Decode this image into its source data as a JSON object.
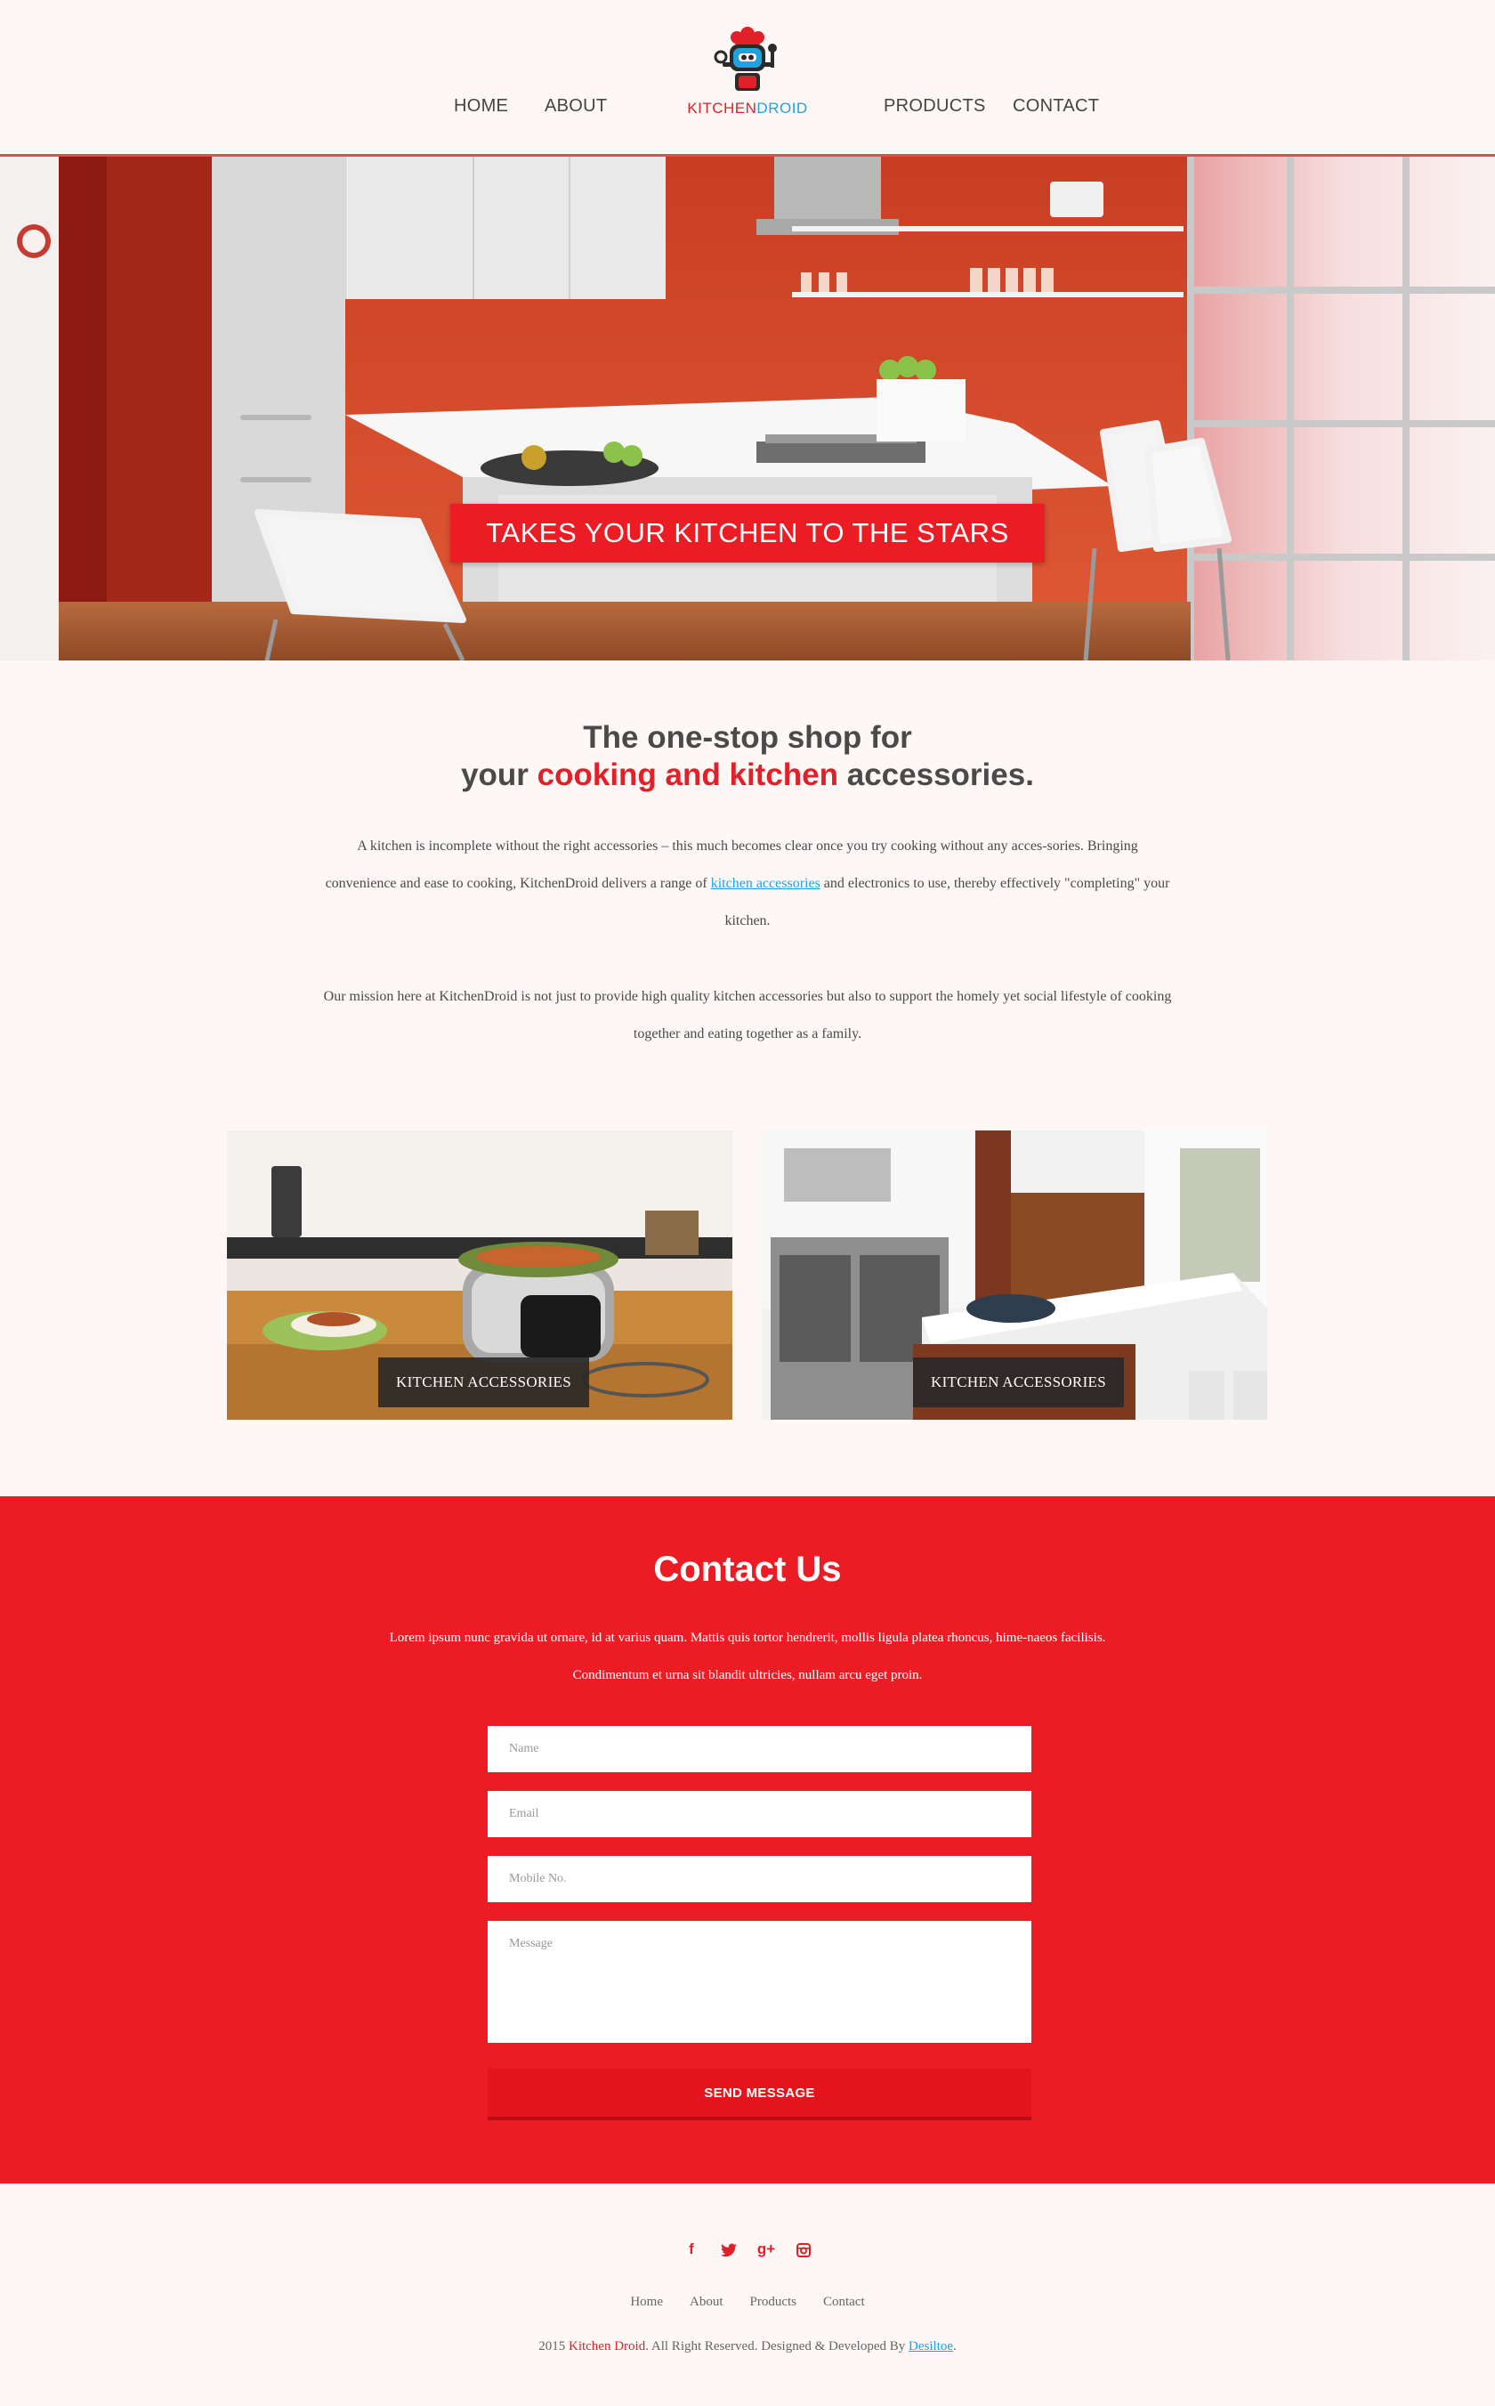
{
  "nav": {
    "home": "HOME",
    "about": "ABOUT",
    "products": "PRODUCTS",
    "contact": "CONTACT"
  },
  "logo": {
    "part1": "KITCHEN",
    "part2": "DROID"
  },
  "hero": {
    "banner": "TAKES YOUR KITCHEN TO THE STARS"
  },
  "intro": {
    "title_line1": "The one-stop shop for",
    "title_pre": "your ",
    "title_highlight": "cooking and kitchen",
    "title_post": " accessories.",
    "p1_a": "A kitchen is incomplete without the right accessories – this much becomes clear once you try cooking without any acces-sories. Bringing convenience and ease to cooking, KitchenDroid delivers a range of ",
    "p1_link": "kitchen accessories",
    "p1_b": " and electronics to use, thereby effectively \"completing\" your kitchen.",
    "p2": "Our mission here at KitchenDroid is not just to provide high quality kitchen accessories but also to support the homely yet social lifestyle of cooking together and eating together as a family."
  },
  "cards": [
    {
      "label": "KITCHEN ACCESSORIES"
    },
    {
      "label": "KITCHEN ACCESSORIES"
    }
  ],
  "contact": {
    "title": "Contact Us",
    "text": "Lorem ipsum nunc gravida ut ornare, id at varius quam. Mattis quis tortor hendrerit, mollis ligula platea rhoncus, hime-naeos facilisis. Condimentum et urna sit blandit ultricies, nullam arcu eget proin.",
    "name_placeholder": "Name",
    "email_placeholder": "Email",
    "mobile_placeholder": "Mobile No.",
    "message_placeholder": "Message",
    "send_label": "SEND MESSAGE"
  },
  "footer": {
    "socials": [
      {
        "icon": "facebook-icon",
        "glyph": "f"
      },
      {
        "icon": "twitter-icon",
        "glyph": "t"
      },
      {
        "icon": "google-plus-icon",
        "glyph": "g+"
      },
      {
        "icon": "instagram-icon",
        "glyph": "◎"
      }
    ],
    "links": [
      "Home",
      "About",
      "Products",
      "Contact"
    ],
    "copy_pre": "2015 ",
    "copy_brand": "Kitchen Droid",
    "copy_mid": ". All Right Reserved. Designed & Developed By ",
    "copy_dev": "Desiltoe",
    "copy_end": "."
  },
  "colors": {
    "accent": "#ec1c24",
    "link": "#1da4dd",
    "background": "#fdf7f5"
  }
}
